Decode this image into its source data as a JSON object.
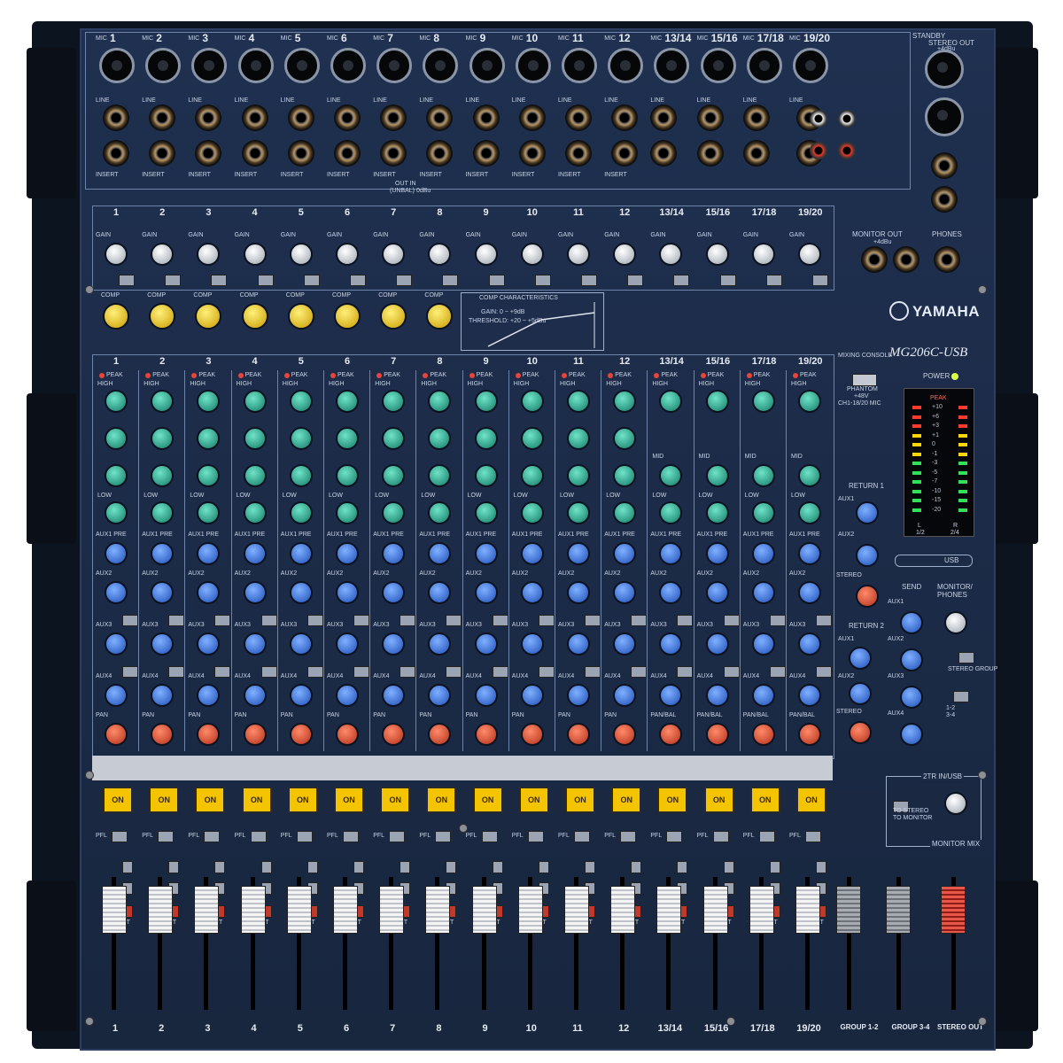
{
  "brand": {
    "name": "YAMAHA",
    "model_prefix": "MIXING CONSOLE",
    "model": "MG206C-USB"
  },
  "input_channels": [
    "1",
    "2",
    "3",
    "4",
    "5",
    "6",
    "7",
    "8",
    "9",
    "10",
    "11",
    "12",
    "13/14",
    "15/16",
    "17/18",
    "19/20"
  ],
  "bottom_labels": [
    "1",
    "2",
    "3",
    "4",
    "5",
    "6",
    "7",
    "8",
    "9",
    "10",
    "11",
    "12",
    "13/14",
    "15/16",
    "17/18",
    "19/20",
    "GROUP 1-2",
    "GROUP 3-4",
    "STEREO OUT"
  ],
  "input_labels": {
    "mic": "MIC",
    "line": "LINE",
    "insert": "INSERT",
    "insert_note": "OUT IN",
    "insert_level": "(UNBAL) 0dBu"
  },
  "gain_label": "GAIN",
  "comp": {
    "label": "COMP",
    "characteristics": "COMP CHARACTERISTICS",
    "gain_line": "GAIN: 0 ~ +9dB",
    "threshold_line": "THRESHOLD: +20 ~ +5dBu"
  },
  "eq": {
    "peak": "PEAK",
    "high": "HIGH",
    "mid": "MID",
    "low": "LOW"
  },
  "aux": {
    "aux1_pre": "AUX1 PRE",
    "aux2": "AUX2",
    "aux3": "AUX3",
    "aux4": "AUX4",
    "pre": "PRE",
    "pan": "PAN",
    "pan_bal": "PAN/BAL"
  },
  "buttons": {
    "on": "ON",
    "pfl": "PFL",
    "st": "ST"
  },
  "top_right": {
    "standby": "STANDBY",
    "stereo_out": "STEREO OUT",
    "stereo_out_level": "+4dBu",
    "monitor_out": "MONITOR OUT",
    "monitor_out_level": "+4dBu",
    "phones": "PHONES"
  },
  "phantom": {
    "label": "PHANTOM",
    "voltage": "+48V",
    "scope": "CH1-18/20 MIC"
  },
  "power_label": "POWER",
  "meter": {
    "peak": "PEAK",
    "scale": [
      "+10",
      "+6",
      "+3",
      "+1",
      "0",
      "-1",
      "-3",
      "-5",
      "-7",
      "-10",
      "-15",
      "-20"
    ],
    "left": "L",
    "right": "R",
    "left_sub": "1/2",
    "right_sub": "2/4"
  },
  "returns": {
    "return1": "RETURN 1",
    "return2": "RETURN 2",
    "aux1": "AUX1",
    "aux2": "AUX2",
    "stereo": "STEREO"
  },
  "usb_label": "USB",
  "master": {
    "send": "SEND",
    "monitor_phones": "MONITOR/ PHONES",
    "stereo_group": "STEREO GROUP",
    "group_12": "1-2",
    "group_34": "3-4",
    "aux1": "AUX1",
    "aux2": "AUX2",
    "aux3": "AUX3",
    "aux4": "AUX4",
    "two_tr": "2TR IN/USB",
    "to_stereo": "TO STEREO",
    "to_monitor": "TO MONITOR",
    "monitor_mix": "MONITOR MIX"
  },
  "colors": {
    "panel": "#1f3050",
    "knob_eq": "#2aa389",
    "knob_aux": "#3a6fd8",
    "knob_pan": "#c9442a",
    "knob_comp": "#e0b800",
    "on_button": "#f5c400"
  }
}
